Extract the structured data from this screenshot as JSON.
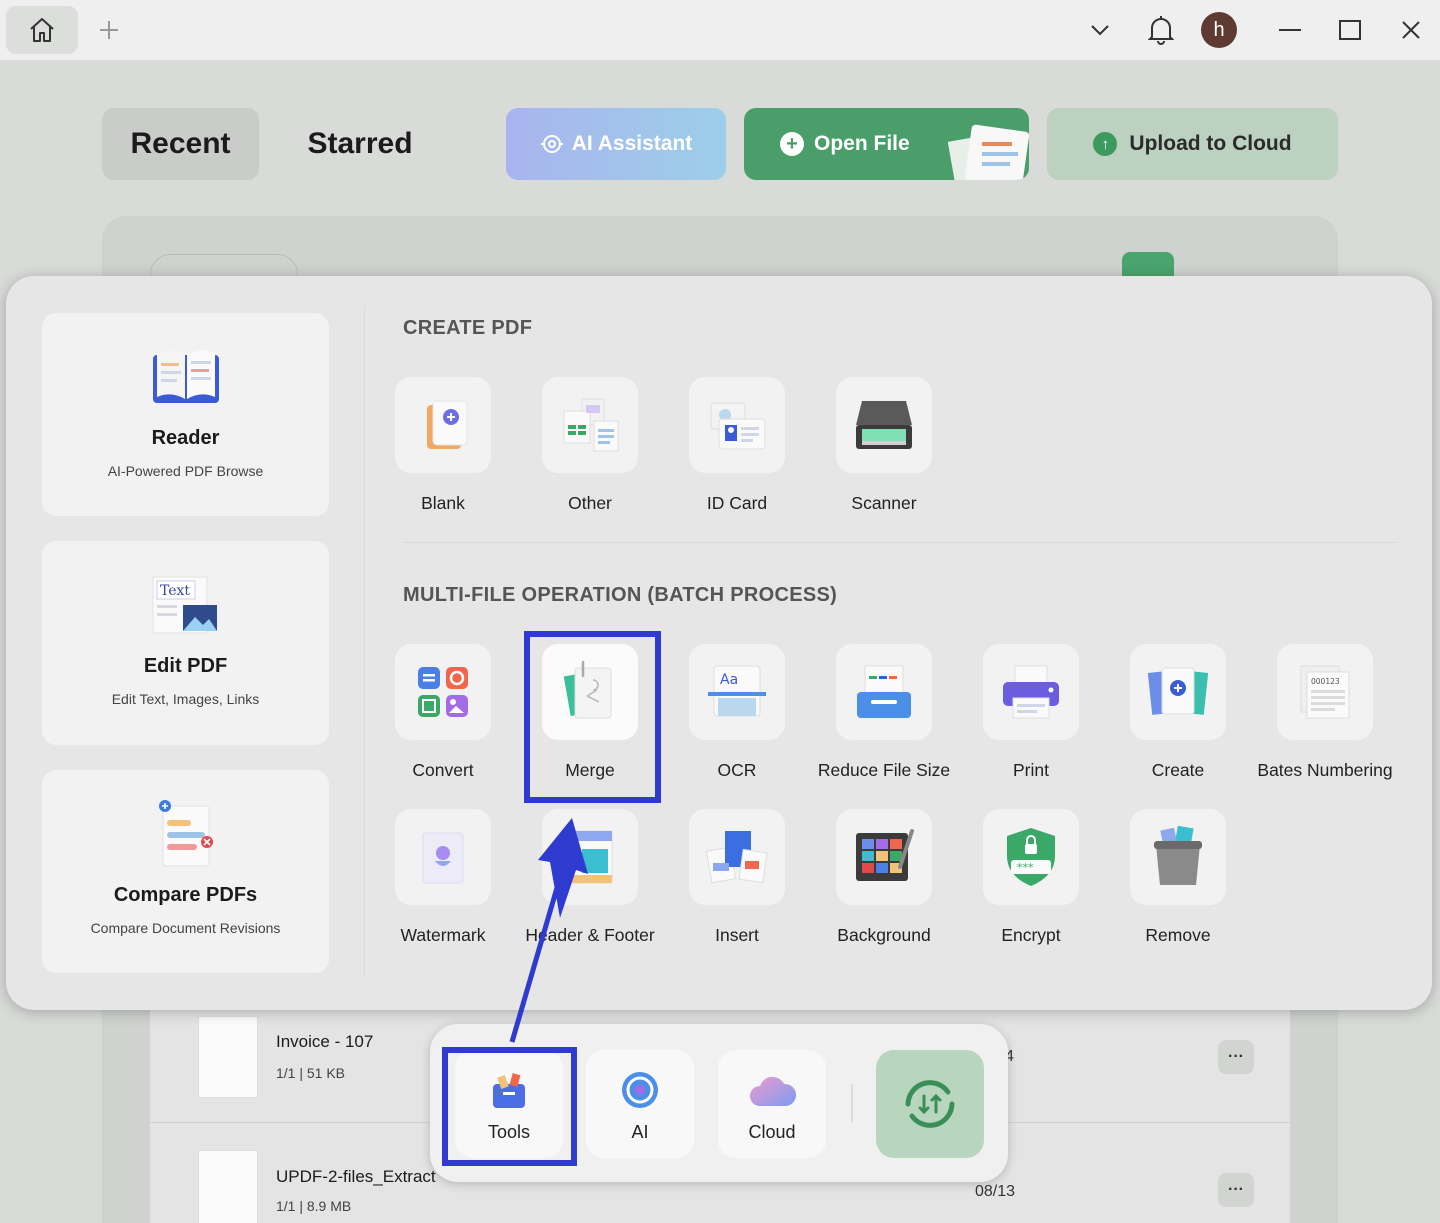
{
  "titlebar": {
    "icons": [
      "home-icon",
      "plus-icon",
      "chevron-down-icon",
      "bell-icon",
      "minimize-icon",
      "maximize-icon",
      "close-icon"
    ],
    "avatar_letter": "h"
  },
  "header": {
    "tabs": [
      {
        "label": "Recent",
        "active": true
      },
      {
        "label": "Starred",
        "active": false
      }
    ],
    "ai_assistant_label": "AI Assistant",
    "open_file_label": "Open File",
    "upload_label": "Upload to Cloud"
  },
  "files": [
    {
      "name": "Invoice - 107",
      "meta": "1/1 | 51 KB",
      "date": "4"
    },
    {
      "name": "UPDF-2-files_Extract",
      "meta": "1/1 | 8.9 MB",
      "date": "08/13"
    }
  ],
  "popup": {
    "left_cards": [
      {
        "title": "Reader",
        "subtitle": "AI-Powered PDF Browse",
        "icon": "reader-icon"
      },
      {
        "title": "Edit PDF",
        "subtitle": "Edit Text, Images, Links",
        "icon": "edit-pdf-icon",
        "icon_text": "Text"
      },
      {
        "title": "Compare PDFs",
        "subtitle": "Compare Document Revisions",
        "icon": "compare-icon"
      }
    ],
    "create_section_title": "CREATE PDF",
    "create_tools": [
      {
        "label": "Blank",
        "icon": "blank-pdf-icon"
      },
      {
        "label": "Other",
        "icon": "other-files-icon"
      },
      {
        "label": "ID Card",
        "icon": "id-card-icon"
      },
      {
        "label": "Scanner",
        "icon": "scanner-icon"
      }
    ],
    "batch_section_title": "MULTI-FILE OPERATION (BATCH PROCESS)",
    "batch_tools_row1": [
      {
        "label": "Convert",
        "icon": "convert-icon"
      },
      {
        "label": "Merge",
        "icon": "merge-icon"
      },
      {
        "label": "OCR",
        "icon": "ocr-icon",
        "icon_text": "Aa"
      },
      {
        "label": "Reduce File Size",
        "icon": "reduce-size-icon"
      },
      {
        "label": "Print",
        "icon": "print-icon"
      },
      {
        "label": "Create",
        "icon": "create-icon"
      },
      {
        "label": "Bates Numbering",
        "icon": "bates-numbering-icon",
        "icon_text": "000123"
      }
    ],
    "batch_tools_row2": [
      {
        "label": "Watermark",
        "icon": "watermark-icon"
      },
      {
        "label": "Header & Footer",
        "icon": "header-footer-icon"
      },
      {
        "label": "Insert",
        "icon": "insert-icon"
      },
      {
        "label": "Background",
        "icon": "background-icon"
      },
      {
        "label": "Encrypt",
        "icon": "encrypt-icon",
        "icon_text": "***"
      },
      {
        "label": "Remove",
        "icon": "remove-icon"
      }
    ]
  },
  "dock": {
    "items": [
      {
        "label": "Tools",
        "icon": "tools-icon",
        "highlighted": true
      },
      {
        "label": "AI",
        "icon": "ai-icon"
      },
      {
        "label": "Cloud",
        "icon": "cloud-icon"
      }
    ],
    "sync_icon": "sync-icon"
  },
  "annotations": {
    "highlight_color": "#2f3bd0",
    "arrow": "arrow-from-tools-to-merge"
  },
  "colors": {
    "open_file_green": "#4a9e6a",
    "upload_green": "#bcd1c0",
    "ai_gradient_start": "#a9b4ee",
    "ai_gradient_end": "#9ccfe9",
    "avatar_brown": "#5e3a33",
    "highlight_blue": "#2f3bd0"
  }
}
